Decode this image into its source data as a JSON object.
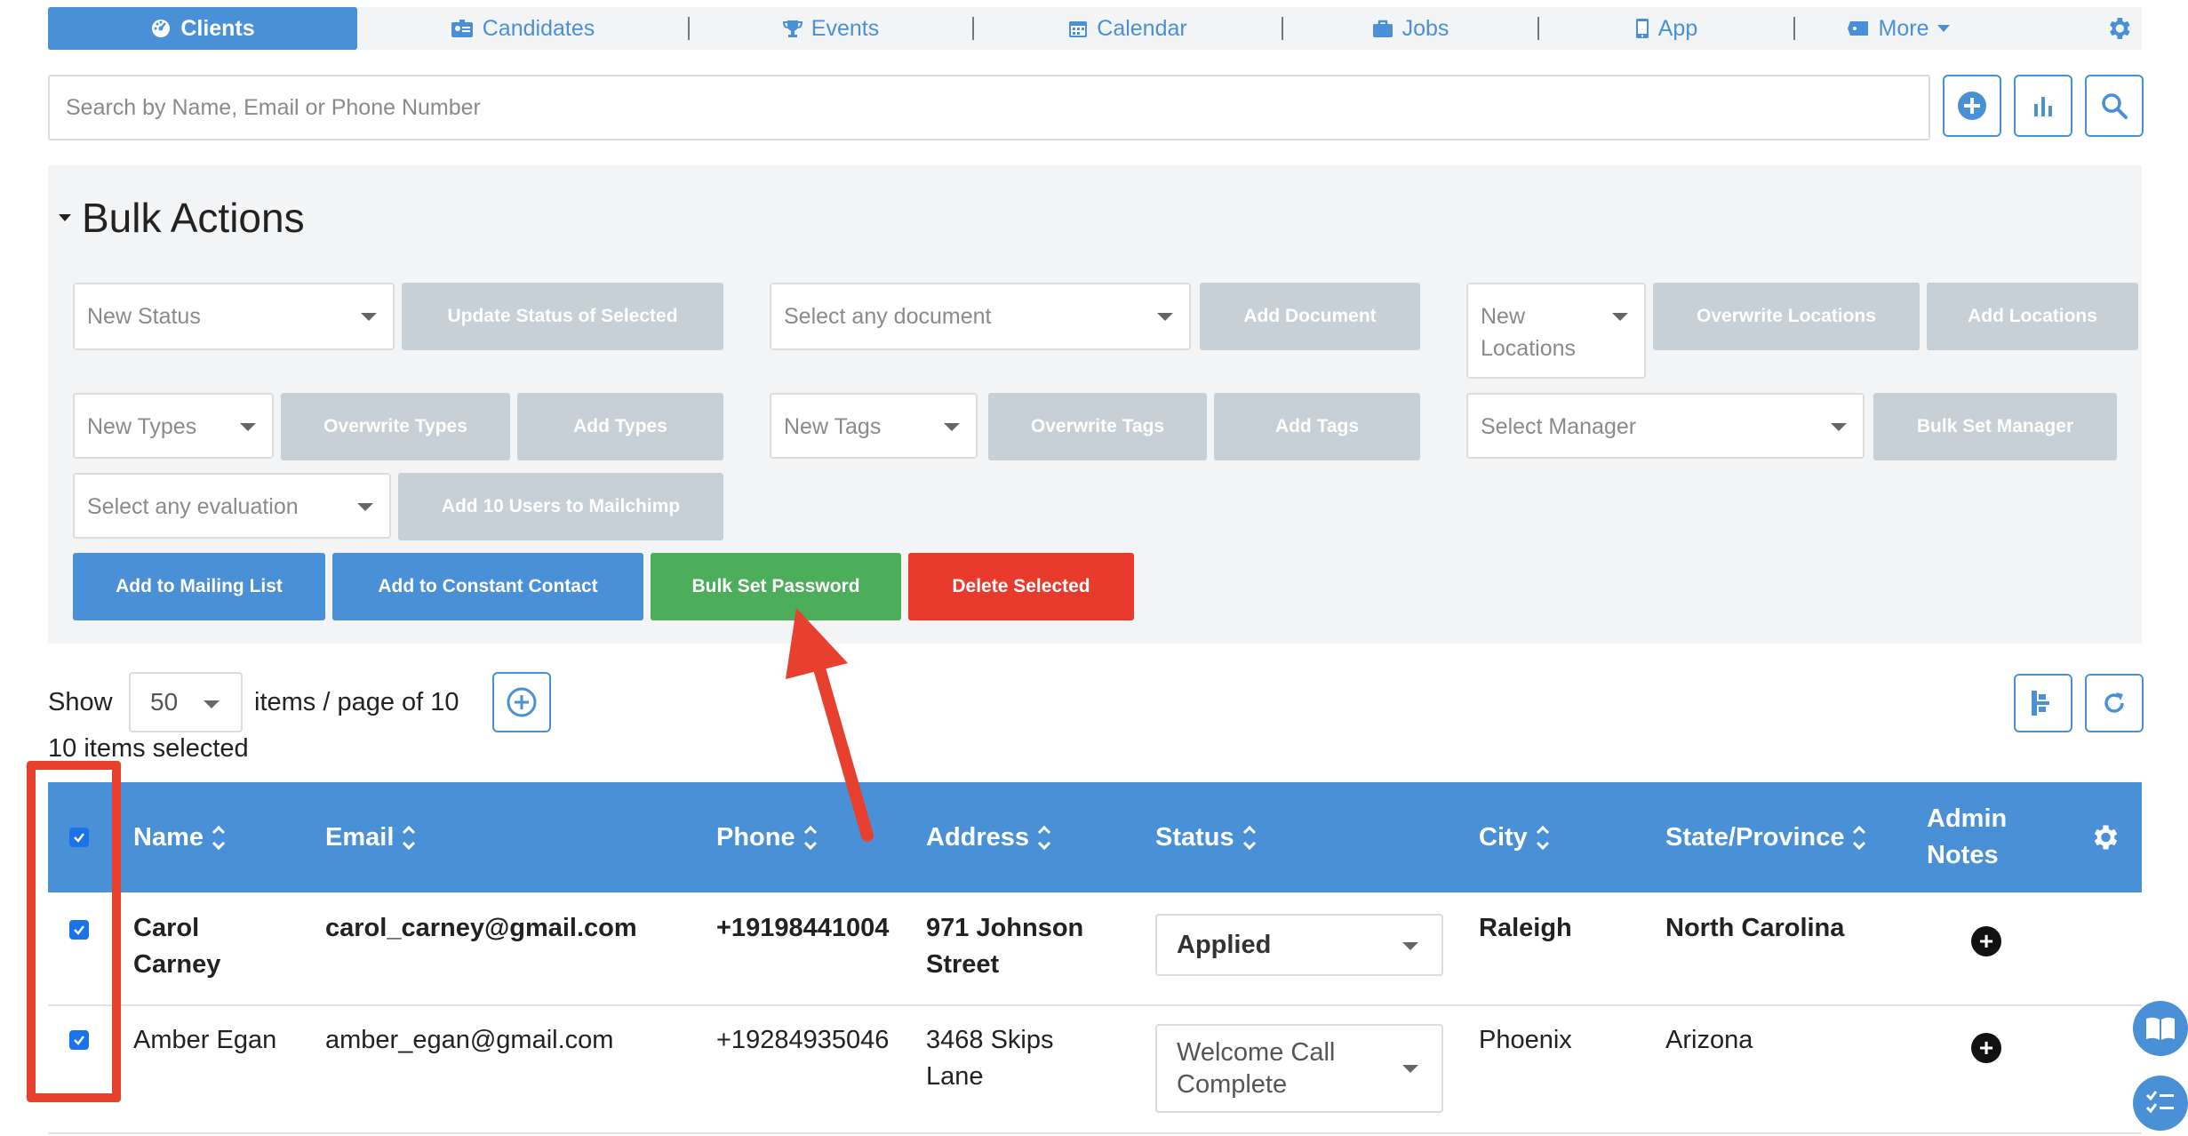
{
  "nav": {
    "tabs": [
      {
        "label": "Clients",
        "icon": "tachometer-icon",
        "active": true
      },
      {
        "label": "Candidates",
        "icon": "id-card-icon"
      },
      {
        "label": "Events",
        "icon": "trophy-icon"
      },
      {
        "label": "Calendar",
        "icon": "calendar-icon"
      },
      {
        "label": "Jobs",
        "icon": "briefcase-icon"
      },
      {
        "label": "App",
        "icon": "mobile-icon"
      },
      {
        "label": "More",
        "icon": "ticket-icon"
      }
    ],
    "settings_icon": "gear-icon"
  },
  "search": {
    "placeholder": "Search by Name, Email or Phone Number"
  },
  "bulk": {
    "title": "Bulk Actions",
    "new_status": "New Status",
    "update_status": "Update Status of Selected",
    "select_document": "Select any document",
    "add_document": "Add Document",
    "new_locations": "New Locations",
    "overwrite_locations": "Overwrite Locations",
    "add_locations": "Add Locations",
    "new_types": "New Types",
    "overwrite_types": "Overwrite Types",
    "add_types": "Add Types",
    "new_tags": "New Tags",
    "overwrite_tags": "Overwrite Tags",
    "add_tags": "Add Tags",
    "select_manager": "Select Manager",
    "bulk_set_manager": "Bulk Set Manager",
    "select_evaluation": "Select any evaluation",
    "add_mailchimp": "Add 10 Users to Mailchimp",
    "add_mailing_list": "Add to Mailing List",
    "add_constant_contact": "Add to Constant Contact",
    "bulk_set_password": "Bulk Set Password",
    "delete_selected": "Delete Selected"
  },
  "pagination": {
    "show_label": "Show",
    "per_page": "50",
    "page_text": "items / page of 10",
    "selected_text": "10 items selected"
  },
  "table": {
    "columns": [
      "Name",
      "Email",
      "Phone",
      "Address",
      "Status",
      "City",
      "State/Province",
      "Admin Notes"
    ],
    "rows": [
      {
        "name": "Carol Carney",
        "email": "carol_carney@gmail.com",
        "phone": "+19198441004",
        "address": "971 Johnson Street",
        "status": "Applied",
        "city": "Raleigh",
        "state": "North Carolina"
      },
      {
        "name": "Amber Egan",
        "email": "amber_egan@gmail.com",
        "phone": "+19284935046",
        "address": "3468 Skips Lane",
        "status": "Welcome Call Complete",
        "city": "Phoenix",
        "state": "Arizona"
      }
    ]
  },
  "colors": {
    "primary": "#4a90d6",
    "disabled_button": "#c7d0d6",
    "success": "#4cae5b",
    "danger": "#e8392d",
    "annotation": "#e8402f"
  }
}
